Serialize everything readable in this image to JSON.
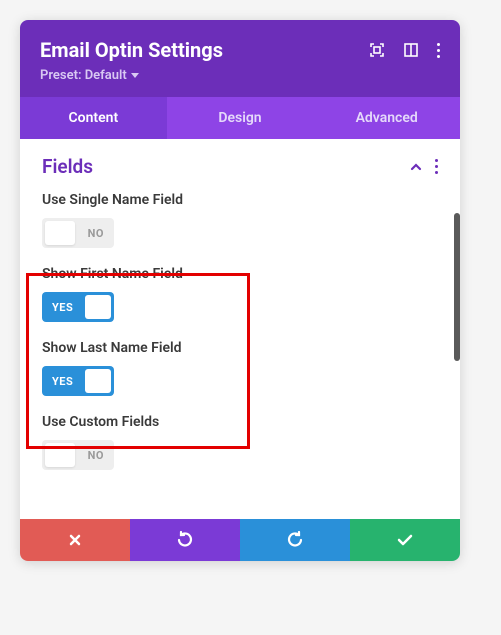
{
  "header": {
    "title": "Email Optin Settings",
    "preset_label": "Preset: Default"
  },
  "tabs": {
    "content": "Content",
    "design": "Design",
    "advanced": "Advanced"
  },
  "section": {
    "title": "Fields"
  },
  "fields": {
    "use_single_name": {
      "label": "Use Single Name Field",
      "state": "NO"
    },
    "show_first_name": {
      "label": "Show First Name Field",
      "state": "YES"
    },
    "show_last_name": {
      "label": "Show Last Name Field",
      "state": "YES"
    },
    "use_custom": {
      "label": "Use Custom Fields",
      "state": "NO"
    }
  }
}
